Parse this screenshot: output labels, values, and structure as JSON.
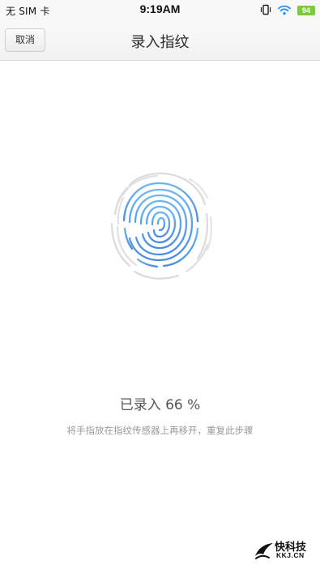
{
  "status_bar": {
    "carrier": "无 SIM 卡",
    "time": "9:19AM",
    "battery_level": "94",
    "icons": [
      "vibrate-icon",
      "wifi-icon",
      "battery-icon"
    ]
  },
  "header": {
    "cancel_label": "取消",
    "title": "录入指纹"
  },
  "fingerprint": {
    "icon": "fingerprint-icon",
    "progress_percent": 66,
    "color_done": "#4a90e2",
    "color_pending": "#dcdcdc"
  },
  "main": {
    "progress_text": "已录入 66 %",
    "instruction": "将手指放在指纹传感器上再移开，重复此步骤"
  },
  "watermark": {
    "name": "快科技",
    "domain": "KKJ.CN"
  }
}
